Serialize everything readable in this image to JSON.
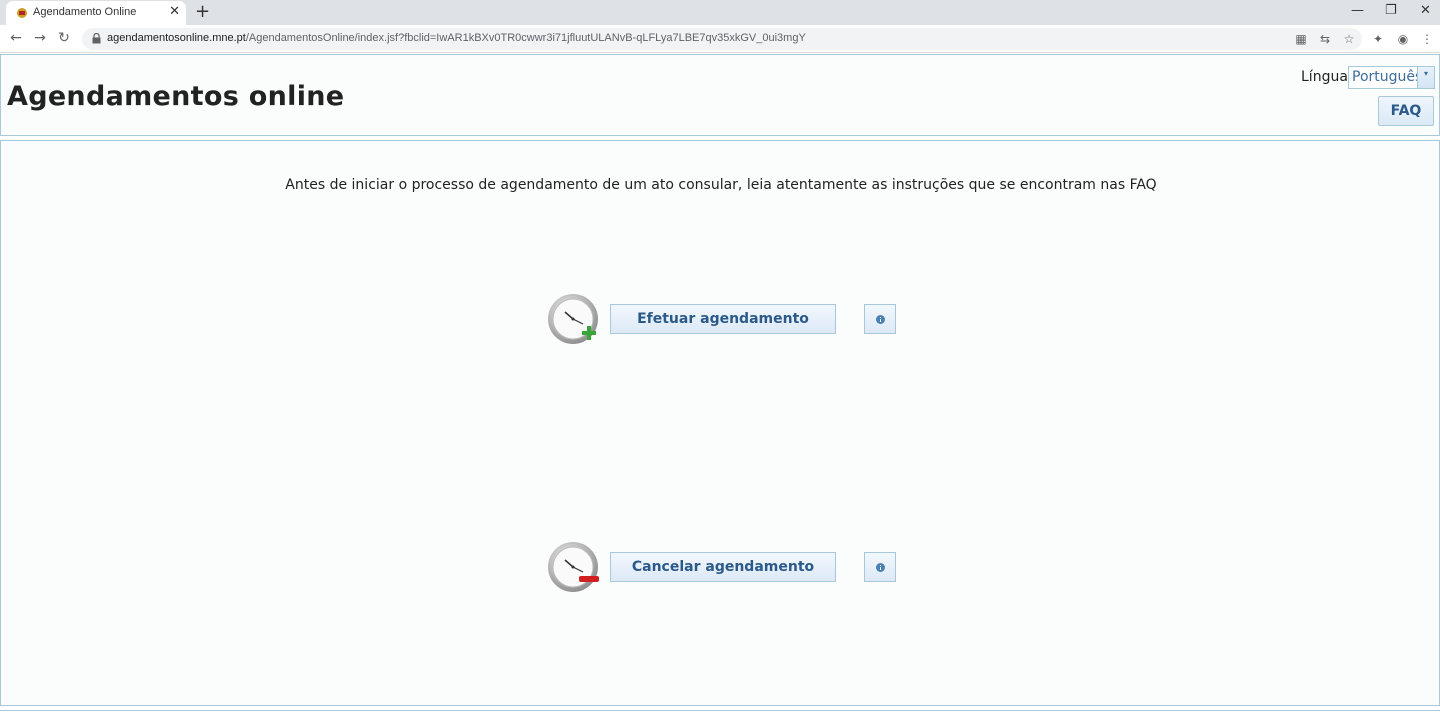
{
  "browser": {
    "tab_title": "Agendamento Online",
    "new_tab": "+",
    "url_host": "agendamentosonline.mne.pt",
    "url_path": "/AgendamentosOnline/index.jsf?fbclid=IwAR1kBXv0TR0cwwr3i71jfluutULANvB-qLFLya7LBE7qv35xkGV_0ui3mgY"
  },
  "header": {
    "title": "Agendamentos online",
    "language_label": "Língua",
    "language_value": "Português",
    "faq_label": "FAQ"
  },
  "main": {
    "instructions": "Antes de iniciar o processo de agendamento de um ato consular, leia atentamente as instruções que se encontram nas FAQ",
    "actions": [
      {
        "label": "Efetuar agendamento",
        "icon": "clock-add-icon"
      },
      {
        "label": "Cancelar agendamento",
        "icon": "clock-remove-icon"
      }
    ]
  },
  "colors": {
    "border": "#a8c8dc",
    "button_text": "#2b5a8a",
    "add_green": "#3aa63a",
    "remove_red": "#d12020"
  }
}
